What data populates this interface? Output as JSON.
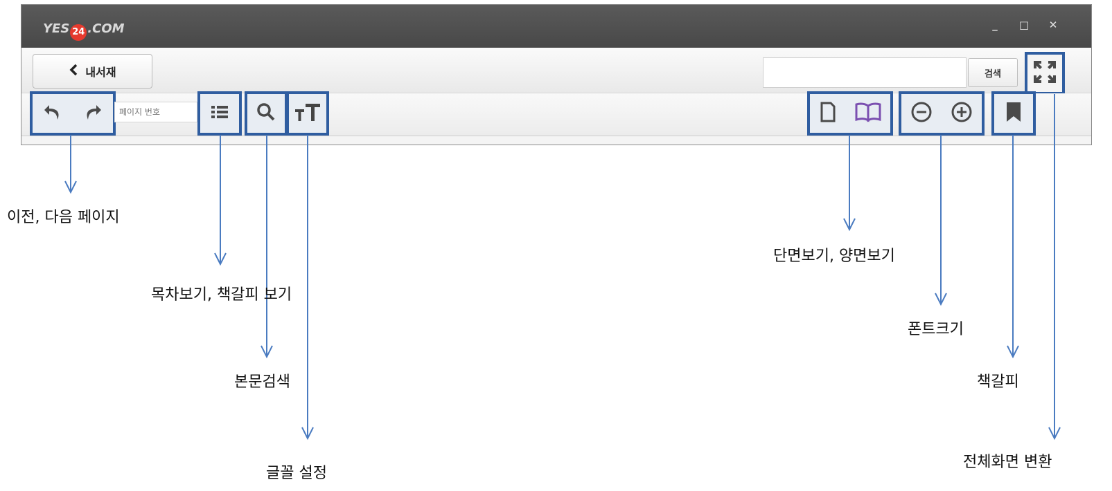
{
  "window": {
    "logo": {
      "prefix": "YES",
      "number": "24",
      "suffix": ".COM"
    },
    "controls": {
      "minimize": "_",
      "maximize": "□",
      "close": "✕"
    }
  },
  "navbar": {
    "back_label": "내서재",
    "search_value": "",
    "search_button": "검색"
  },
  "toolbar": {
    "page_input_placeholder": "페이지 번호",
    "font_setting_glyph": "TT"
  },
  "annotations": {
    "prev_next": "이전, 다음 페이지",
    "toc_bookmark_view": "목차보기, 책갈피 보기",
    "text_search": "본문검색",
    "font_setting": "글꼴 설정",
    "page_view": "단면보기, 양면보기",
    "font_size": "폰트크기",
    "bookmark": "책갈피",
    "fullscreen": "전체화면 변환"
  },
  "colors": {
    "highlight_border": "#2f5da0",
    "arrow": "#4a7bc0",
    "book_icon": "#7b4fb0",
    "titlebar": "#4f4f4f"
  },
  "icons": [
    "undo-icon",
    "redo-icon",
    "list-icon",
    "search-icon",
    "font-size-icon",
    "single-page-icon",
    "book-open-icon",
    "zoom-out-icon",
    "zoom-in-icon",
    "bookmark-icon",
    "fullscreen-icon"
  ]
}
